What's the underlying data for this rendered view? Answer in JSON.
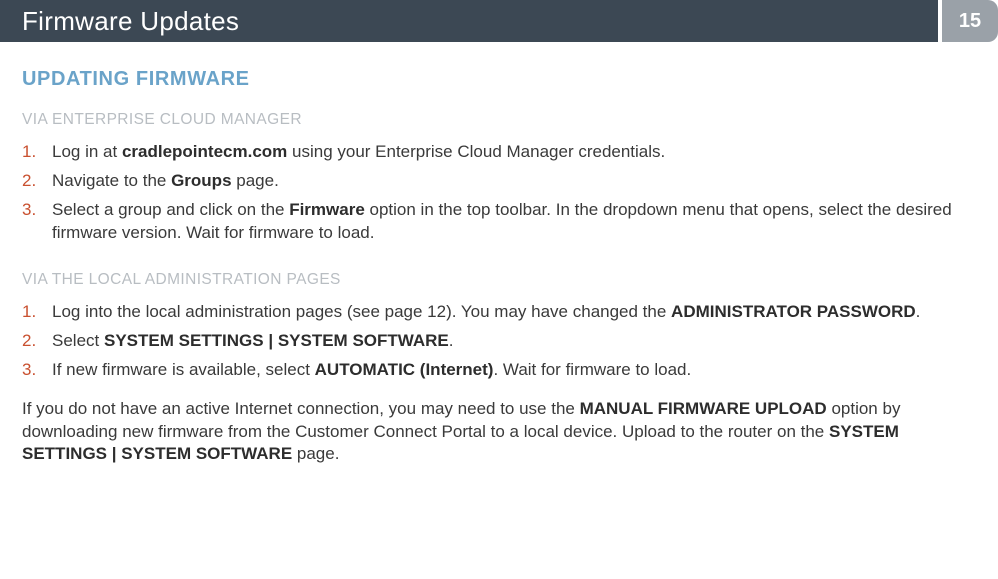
{
  "header": {
    "title": "Firmware Updates",
    "page_number": "15"
  },
  "section_heading": "UPDATING FIRMWARE",
  "ecm": {
    "subheading": "VIA ENTERPRISE CLOUD MANAGER",
    "steps": [
      {
        "pre": "Log in at ",
        "bold1": "cradlepointecm.com",
        "post1": " using your Enterprise Cloud Manager credentials."
      },
      {
        "pre": "Navigate to the ",
        "bold1": "Groups",
        "post1": " page."
      },
      {
        "pre": "Select a group and click on the ",
        "bold1": "Firmware",
        "post1": " option in the top toolbar. In the dropdown menu that opens, select the desired firmware version. Wait for firmware to load."
      }
    ]
  },
  "local": {
    "subheading": "VIA THE LOCAL ADMINISTRATION PAGES",
    "steps": [
      {
        "pre": "Log into the local administration pages (see page 12). You may have changed the ",
        "bold1": "ADMINISTRATOR PASSWORD",
        "post1": "."
      },
      {
        "pre": "Select ",
        "bold1": "SYSTEM SETTINGS | SYSTEM SOFTWARE",
        "post1": "."
      },
      {
        "pre": "If new firmware is available, select ",
        "bold1": "AUTOMATIC (Internet)",
        "post1": ". Wait for firmware to load."
      }
    ]
  },
  "note": {
    "pre": "If you do not have an active Internet connection, you may need to use the ",
    "bold1": "MANUAL FIRMWARE UPLOAD",
    "mid1": " option by downloading new firmware from the Customer Connect Portal to a local device. Upload to the router on the ",
    "bold2": "SYSTEM SETTINGS | SYSTEM SOFTWARE",
    "post": " page."
  }
}
